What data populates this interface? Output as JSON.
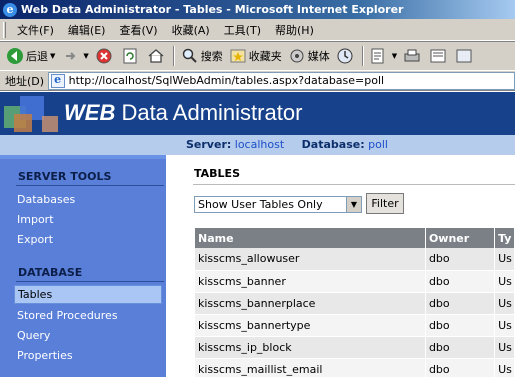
{
  "window": {
    "title": "Web Data Administrator - Tables - Microsoft Internet Explorer"
  },
  "menu": [
    "文件(F)",
    "编辑(E)",
    "查看(V)",
    "收藏(A)",
    "工具(T)",
    "帮助(H)"
  ],
  "toolbar": {
    "back": "后退",
    "search": "搜索",
    "favorites": "收藏夹",
    "media": "媒体"
  },
  "address": {
    "label": "地址(D)",
    "url": "http://localhost/SqlWebAdmin/tables.aspx?database=poll"
  },
  "banner": {
    "brand_bold": "WEB",
    "brand_rest": " Data Administrator"
  },
  "info": {
    "server_label": "Server:",
    "server": "localhost",
    "database_label": "Database:",
    "database": "poll"
  },
  "sidebar": {
    "server_tools_title": "SERVER TOOLS",
    "server_tools": [
      "Databases",
      "Import",
      "Export"
    ],
    "database_title": "DATABASE",
    "database_items": [
      "Tables",
      "Stored Procedures",
      "Query",
      "Properties"
    ],
    "selected": "Tables"
  },
  "content": {
    "heading": "TABLES",
    "filter_value": "Show User Tables Only",
    "filter_button": "Filter",
    "columns": [
      "Name",
      "Owner",
      "Ty"
    ],
    "rows": [
      {
        "name": "kisscms_allowuser",
        "owner": "dbo",
        "type": "Us"
      },
      {
        "name": "kisscms_banner",
        "owner": "dbo",
        "type": "Us"
      },
      {
        "name": "kisscms_bannerplace",
        "owner": "dbo",
        "type": "Us"
      },
      {
        "name": "kisscms_bannertype",
        "owner": "dbo",
        "type": "Us"
      },
      {
        "name": "kisscms_ip_block",
        "owner": "dbo",
        "type": "Us"
      },
      {
        "name": "kisscms_maillist_email",
        "owner": "dbo",
        "type": "Us"
      }
    ]
  },
  "colors": {
    "banner": "#17428b",
    "infobar": "#b5ccec",
    "sidebar": "#5a7fd8",
    "table_header": "#7b8087"
  }
}
